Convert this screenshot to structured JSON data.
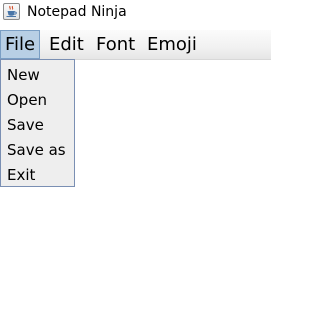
{
  "window": {
    "title": "Notepad Ninja",
    "icon": "java-cup-icon"
  },
  "menu_bar": {
    "items": [
      {
        "label": "File",
        "selected": true
      },
      {
        "label": "Edit",
        "selected": false
      },
      {
        "label": "Font",
        "selected": false
      },
      {
        "label": "Emoji",
        "selected": false
      }
    ]
  },
  "file_menu": {
    "items": [
      "New",
      "Open",
      "Save",
      "Save as",
      "Exit"
    ]
  },
  "colors": {
    "selected_menu_bg": "#b8cfe5",
    "selected_menu_border": "#7a9ec4",
    "dropdown_bg": "#eeeeee",
    "dropdown_border": "#7a8fb3"
  }
}
